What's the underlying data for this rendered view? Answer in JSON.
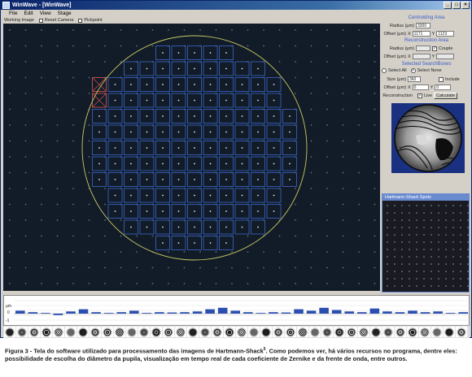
{
  "window": {
    "title": "WinWave - [WinWave]"
  },
  "menu": [
    "File",
    "Edit",
    "View",
    "Stage"
  ],
  "toolbar": {
    "working_image": "Working Image",
    "reset_camera": "Reset Camera",
    "pickpoint": "Pickpoint"
  },
  "right_panel": {
    "centroiding_title": "Centroiding Area",
    "radius_label": "Radius (µm)",
    "radius_value": "3300",
    "offset_label": "Offset (µm)",
    "offset_x_label": "X",
    "offset_x_value": "1171",
    "offset_y_label": "Y",
    "offset_y_value": "1123",
    "reconstruction_title": "Reconstruction Area",
    "rec_radius_label": "Radius (µm)",
    "couple_label": "Couple",
    "couple_checked": true,
    "rec_offset_label": "Offset (µm)",
    "selected_title": "Selected SearchBoxes",
    "select_all_label": "Select All",
    "select_none_label": "Select None",
    "size_label": "Size (µm)",
    "size_value": "360",
    "include_label": "Include",
    "sb_offset_label": "Offset (µm)",
    "sb_offset_x": "0",
    "sb_offset_y": "0",
    "reconstruction_label": "Reconstruction",
    "live_label": "Live",
    "live_checked": true,
    "calculate_label": "Calculate"
  },
  "hs_panel": {
    "title": "Hartmann-Shack Spots"
  },
  "plot": {
    "y_label": "µm",
    "tick_top": "0",
    "tick_bottom": "-1"
  },
  "caption": {
    "lead": "Figura 3 - Tela do software utilizado para processamento das imagens de Hartmann-Shack",
    "ref": "5",
    "rest": ". Como podemos ver, há vários recursos no programa, dentre eles: possibilidade de escolha do diâmetro da pupila, visualização em tempo real de cada coeficiente de Zernike e da frente de onda, entre outros."
  },
  "colors": {
    "grid_box": "#3c66c8",
    "pupil_circle": "#c8c864",
    "selected_box": "#c85050",
    "image_bg": "#121c28"
  },
  "zernike_bar_values": [
    0.2,
    0.1,
    0.05,
    -0.1,
    0.15,
    0.3,
    0.1,
    0.05,
    0.1,
    0.2,
    0.05,
    0.1,
    0.08,
    0.1,
    0.15,
    0.3,
    0.4,
    0.2,
    0.1,
    0.05,
    0.1,
    0.08,
    0.3,
    0.2,
    0.4,
    0.25,
    0.15,
    0.1,
    0.35,
    0.15,
    0.1,
    0.2,
    0.1,
    0.15,
    0.05,
    0.1
  ]
}
